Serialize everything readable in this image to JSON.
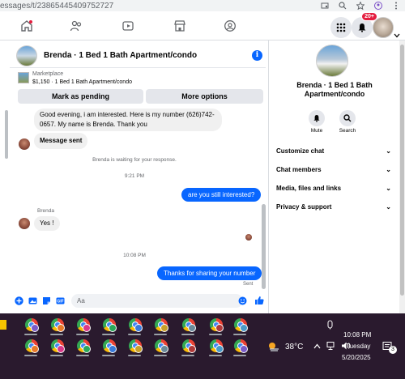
{
  "browser": {
    "url": "essages/t/23865445409752727",
    "icons": [
      "cast-icon",
      "search-icon",
      "star-icon",
      "account-icon",
      "menu-icon"
    ]
  },
  "nav": {
    "icons": [
      "home-icon",
      "friends-icon",
      "video-icon",
      "marketplace-icon",
      "groups-icon"
    ],
    "notif_badge": "20+"
  },
  "chat": {
    "header_title": "Brenda · 1 Bed 1 Bath Apartment/condo",
    "marketplace_label": "Marketplace",
    "listing_line": "$1,150 · 1 Bed 1 Bath Apartment/condo",
    "mark_pending": "Mark as pending",
    "more_options": "More options",
    "messages": {
      "incoming_1": "Good evening, i am interested. Here is my number (626)742-0657. My name is Brenda. Thank you",
      "incoming_2": "Message sent",
      "waiting": "Brenda is waiting for your response.",
      "time_1": "9:21 PM",
      "outgoing_1": "are you still interested?",
      "sender_name": "Brenda",
      "incoming_3": "Yes !",
      "time_2": "10:08 PM",
      "outgoing_2": "Thanks for sharing your number",
      "status": "Sent"
    },
    "composer_placeholder": "Aa"
  },
  "details": {
    "title": "Brenda · 1 Bed 1 Bath Apartment/condo",
    "mute_label": "Mute",
    "search_label": "Search",
    "sections": [
      "Customize chat",
      "Chat members",
      "Media, files and links",
      "Privacy & support"
    ]
  },
  "taskbar": {
    "temperature": "38°C",
    "time": "10:08 PM",
    "day": "Tuesday",
    "date": "5/20/2025",
    "notif_count": "3"
  },
  "colors": {
    "accent": "#0866ff",
    "taskbar": "#2a1a2e"
  }
}
